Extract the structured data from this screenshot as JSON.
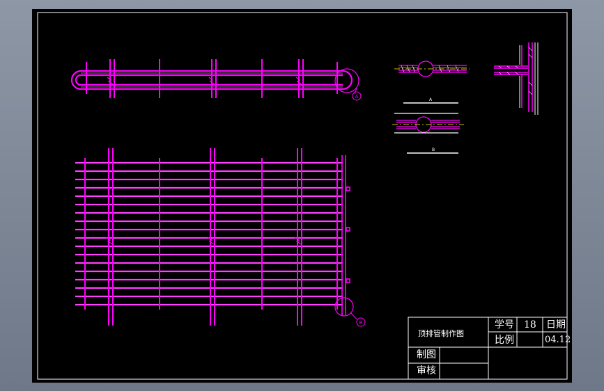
{
  "title_block": {
    "drawing_title": "顶排管制作图",
    "student_no_label": "学号",
    "student_no_value": "18",
    "date_label": "日期",
    "scale_label": "比例",
    "date_value": "04.12",
    "drafter_label": "制图",
    "reviewer_label": "审核"
  },
  "callouts": {
    "detail_a": "A",
    "detail_b": "B",
    "section_a": "A",
    "section_b": "B"
  },
  "colors": {
    "background": "#000000",
    "frame": "#ffffff",
    "pipe": "#ff00ff",
    "pipe_highlight": "#ffffff",
    "center_line": "#ffff00"
  }
}
